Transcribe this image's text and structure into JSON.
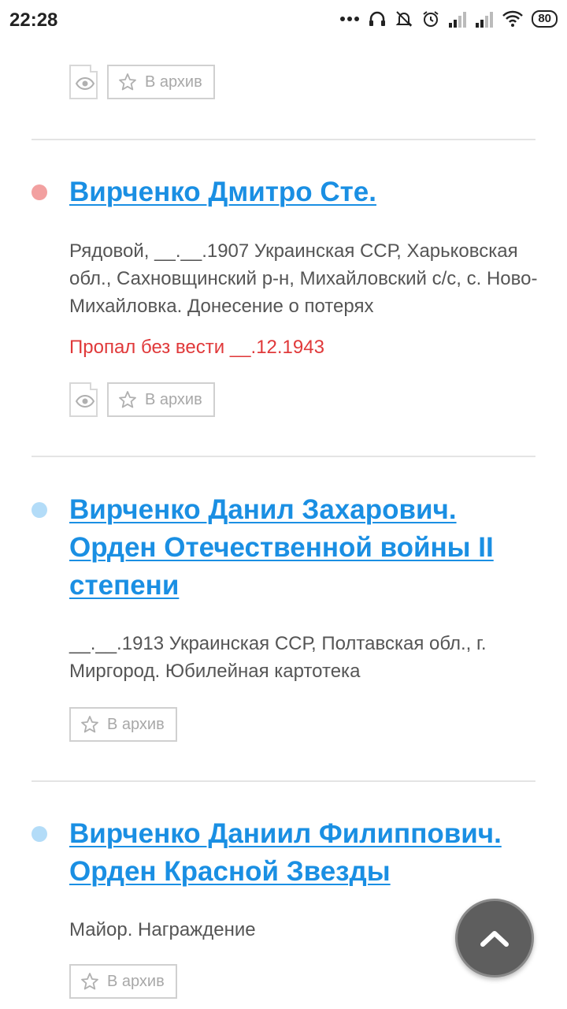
{
  "status_bar": {
    "time": "22:28",
    "battery": "80"
  },
  "archive_label": "В архив",
  "records": [
    {
      "title": "Вирченко Дмитро Сте.",
      "description": "Рядовой, __.__.1907 Украинская ССР, Харьковская обл., Сахновщинский р-н, Михайловский с/с, с. Ново-Михайловка. Донесение о потерях",
      "status": "Пропал без вести __.12.1943",
      "marker_color": "#f2a0a0"
    },
    {
      "title": "Вирченко Данил Захарович. Орден Отечественной войны II степени",
      "description": "__.__.1913 Украинская ССР, Полтавская обл., г. Миргород. Юбилейная картотека",
      "marker_color": "#b3dcf8"
    },
    {
      "title": "Вирченко Даниил Филиппович. Орден Красной Звезды",
      "description": "Майор. Награждение",
      "marker_color": "#b3dcf8"
    }
  ],
  "colors": {
    "link": "#1a8fe3",
    "status_red": "#e0393a",
    "text": "#555555"
  },
  "icons": [
    "eye-icon",
    "star-icon",
    "chevron-up-icon"
  ]
}
